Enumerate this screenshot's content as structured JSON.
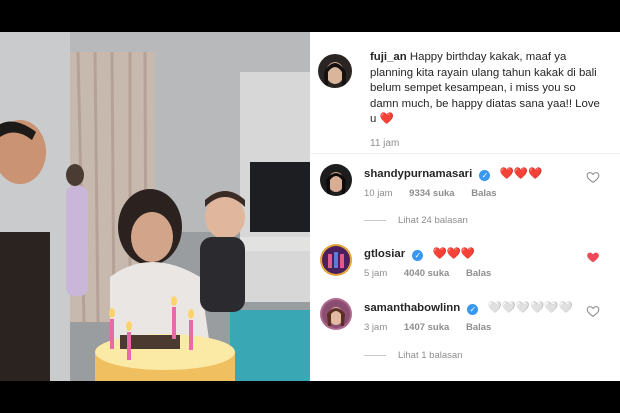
{
  "post": {
    "photo_alt": "",
    "caption": {
      "username": "fuji_an",
      "text": "Happy birthday kakak, maaf ya planning kita rayain ulang tahun kakak di bali belum sempet kesampean, i miss you so damn much, be happy diatas sana yaa!! Love u ❤️",
      "time": "11 jam"
    }
  },
  "comments": [
    {
      "username": "shandypurnamasari",
      "verified": true,
      "text": "❤️❤️❤️",
      "time": "10 jam",
      "likes": "9334 suka",
      "reply_label": "Balas",
      "liked": false,
      "view_replies": "Lihat 24 balasan",
      "avatar_color": "#1d1d1d"
    },
    {
      "username": "gtlosiar",
      "verified": true,
      "text": "❤️❤️❤️",
      "time": "5 jam",
      "likes": "4040 suka",
      "reply_label": "Balas",
      "liked": true,
      "view_replies": "",
      "avatar_color": "#5b2a6e"
    },
    {
      "username": "samanthabowlinn",
      "verified": true,
      "text": "🤍🤍🤍🤍🤍🤍",
      "time": "3 jam",
      "likes": "1407 suka",
      "reply_label": "Balas",
      "liked": false,
      "view_replies": "Lihat 1 balasan",
      "avatar_color": "#b06a8c"
    }
  ],
  "colors": {
    "accent": "#3897f0",
    "like_red": "#ed4956",
    "muted": "#8e8e8e",
    "text": "#262626"
  }
}
